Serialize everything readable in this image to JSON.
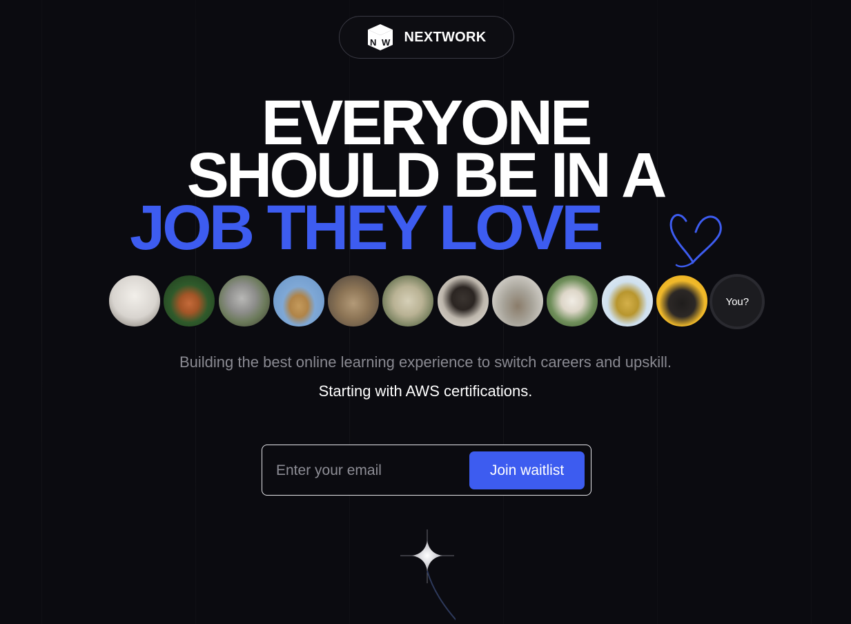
{
  "brand": {
    "name": "NEXTWORK",
    "logo_letters": [
      "N",
      "W"
    ]
  },
  "headline": {
    "line1": "EVERYONE",
    "line2": "SHOULD BE IN A",
    "line3": "JOB THEY LOVE"
  },
  "avatars": {
    "you_label": "You?",
    "items": [
      {
        "name": "fluffy-dog",
        "bg": "#d8d4cf",
        "fg": "#f1eeea"
      },
      {
        "name": "squirrel",
        "bg": "#2f5a2b",
        "fg": "#c46a3a"
      },
      {
        "name": "koala",
        "bg": "#6b7a5a",
        "fg": "#9a9a9a"
      },
      {
        "name": "giraffe",
        "bg": "#7fa8d6",
        "fg": "#c49a5c"
      },
      {
        "name": "kitten",
        "bg": "#8a8070",
        "fg": "#b39a78"
      },
      {
        "name": "pug-blanket",
        "bg": "#6f7a58",
        "fg": "#d5cfb7"
      },
      {
        "name": "pug-glasses",
        "bg": "#e7e3dc",
        "fg": "#3a3430"
      },
      {
        "name": "seal",
        "bg": "#a8a49a",
        "fg": "#8a7c6a"
      },
      {
        "name": "alpaca",
        "bg": "#6f8e5a",
        "fg": "#f0ece4"
      },
      {
        "name": "pineapple",
        "bg": "#cfe0ee",
        "fg": "#d4b04a"
      },
      {
        "name": "pug-yellow",
        "bg": "#f0b92a",
        "fg": "#1f1d1c"
      }
    ]
  },
  "tagline": {
    "line1": "Building the best online learning experience to switch careers and upskill.",
    "line2": "Starting with AWS certifications."
  },
  "waitlist": {
    "email_placeholder": "Enter your email",
    "button_label": "Join waitlist"
  },
  "colors": {
    "background": "#0b0b10",
    "accent": "#3d5cf0"
  }
}
